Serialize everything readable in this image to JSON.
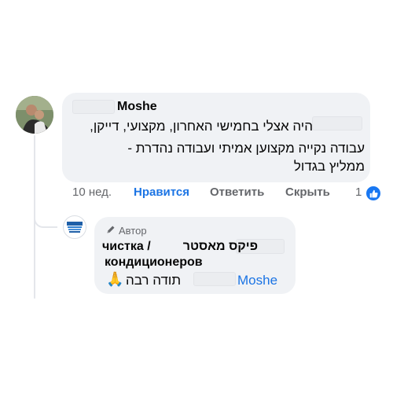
{
  "comment": {
    "author": "Moshe",
    "text_lines": [
      "היה אצלי בחמישי האחרון, מקצועי, דייקן,",
      "עבודה נקייה מקצוען אמיתי ועבודה נהדרת -",
      "ממליץ בגדול"
    ],
    "actions": {
      "time": "10 нед.",
      "like": "Нравится",
      "reply": "Ответить",
      "hide": "Скрыть"
    },
    "reaction_count": "1"
  },
  "reply": {
    "badge": "Автор",
    "page_name_he": "פיקס מאסטר",
    "page_name_ru_part1": "чистка /",
    "page_name_ru_part2": "кондиционеров",
    "thanks": "תודה רבה",
    "mention": "Moshe",
    "emoji": "🙏"
  },
  "colors": {
    "bubble": "#f0f2f5",
    "link_blue": "#1b74e4",
    "meta_gray": "#65676b",
    "like_blue": "#1877f2"
  },
  "icons": [
    "pencil-icon",
    "like-reaction-icon",
    "pray-emoji"
  ]
}
